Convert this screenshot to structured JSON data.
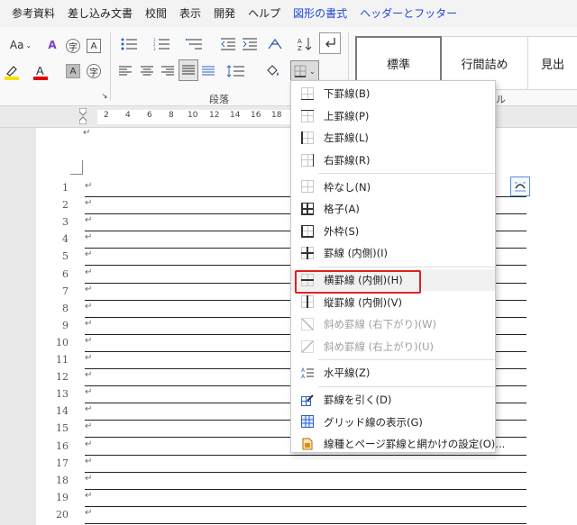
{
  "menubar": {
    "items": [
      "参考資料",
      "差し込み文書",
      "校閲",
      "表示",
      "開発",
      "ヘルプ",
      "図形の書式",
      "ヘッダーとフッター"
    ]
  },
  "ribbon": {
    "font_aa_label": "Aa",
    "char_border_label": "A",
    "phonetic_label": "字",
    "paragraph_group_label": "段落",
    "styles": [
      "標準",
      "行間詰め",
      "見出"
    ],
    "partial_group_label": "ル"
  },
  "ruler": {
    "numbers": [
      "2",
      "4",
      "6",
      "8",
      "10",
      "12",
      "14",
      "16",
      "18"
    ]
  },
  "document": {
    "line_numbers": [
      "1",
      "2",
      "3",
      "4",
      "5",
      "6",
      "7",
      "8",
      "9",
      "10",
      "11",
      "12",
      "13",
      "14",
      "15",
      "16",
      "17",
      "18",
      "19",
      "20"
    ],
    "return_mark": "↵"
  },
  "border_menu": {
    "items": [
      {
        "label": "下罫線(B)",
        "icon": "bottom-border-icon",
        "disabled": false
      },
      {
        "label": "上罫線(P)",
        "icon": "top-border-icon",
        "disabled": false
      },
      {
        "label": "左罫線(L)",
        "icon": "left-border-icon",
        "disabled": false
      },
      {
        "label": "右罫線(R)",
        "icon": "right-border-icon",
        "disabled": false
      },
      {
        "label": "枠なし(N)",
        "icon": "no-border-icon",
        "disabled": false,
        "separator_before": true
      },
      {
        "label": "格子(A)",
        "icon": "all-borders-icon",
        "disabled": false
      },
      {
        "label": "外枠(S)",
        "icon": "outside-borders-icon",
        "disabled": false
      },
      {
        "label": "罫線 (内側)(I)",
        "icon": "inside-borders-icon",
        "disabled": false
      },
      {
        "label": "横罫線 (内側)(H)",
        "icon": "inside-horizontal-border-icon",
        "disabled": false,
        "highlight": true,
        "separator_before": true
      },
      {
        "label": "縦罫線 (内側)(V)",
        "icon": "inside-vertical-border-icon",
        "disabled": false
      },
      {
        "label": "斜め罫線 (右下がり)(W)",
        "icon": "diagonal-down-border-icon",
        "disabled": true
      },
      {
        "label": "斜め罫線 (右上がり)(U)",
        "icon": "diagonal-up-border-icon",
        "disabled": true
      },
      {
        "label": "水平線(Z)",
        "icon": "horizontal-line-icon",
        "disabled": false,
        "separator_before": true
      },
      {
        "label": "罫線を引く(D)",
        "icon": "draw-table-icon",
        "disabled": false,
        "separator_before": true
      },
      {
        "label": "グリッド線の表示(G)",
        "icon": "view-gridlines-icon",
        "disabled": false
      },
      {
        "label": "線種とページ罫線と網かけの設定(O)...",
        "icon": "borders-shading-icon",
        "disabled": false
      }
    ]
  },
  "colors": {
    "accent_menu": "#1e47d6",
    "highlight_border": "#e02020",
    "font_color_bar": "#e00000",
    "highlighter_bar": "#f5e400"
  }
}
